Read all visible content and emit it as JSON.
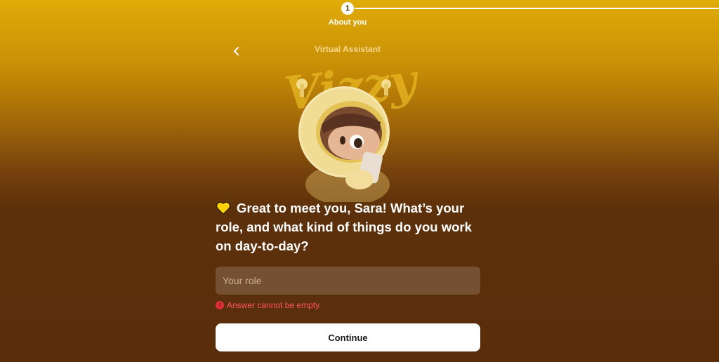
{
  "stepper": {
    "step_number": "1",
    "step_label": "About you"
  },
  "header": {
    "back_icon": "chevron-left-icon",
    "assistant_label": "Virtual Assistant",
    "logo_text": "Vizzy"
  },
  "question": {
    "emoji_icon": "yellow-heart-icon",
    "text": "Great to meet you, Sara! What’s your role, and what kind of things do you work on day-to-day?"
  },
  "form": {
    "role_placeholder": "Your role",
    "role_value": "",
    "error_icon": "error-icon",
    "error_message": "Answer cannot be empty.",
    "continue_label": "Continue"
  },
  "colors": {
    "gradient_top": "#e0ac08",
    "gradient_bottom": "#5a2e0b",
    "error": "#ff5563",
    "heart": "#ffd000"
  }
}
